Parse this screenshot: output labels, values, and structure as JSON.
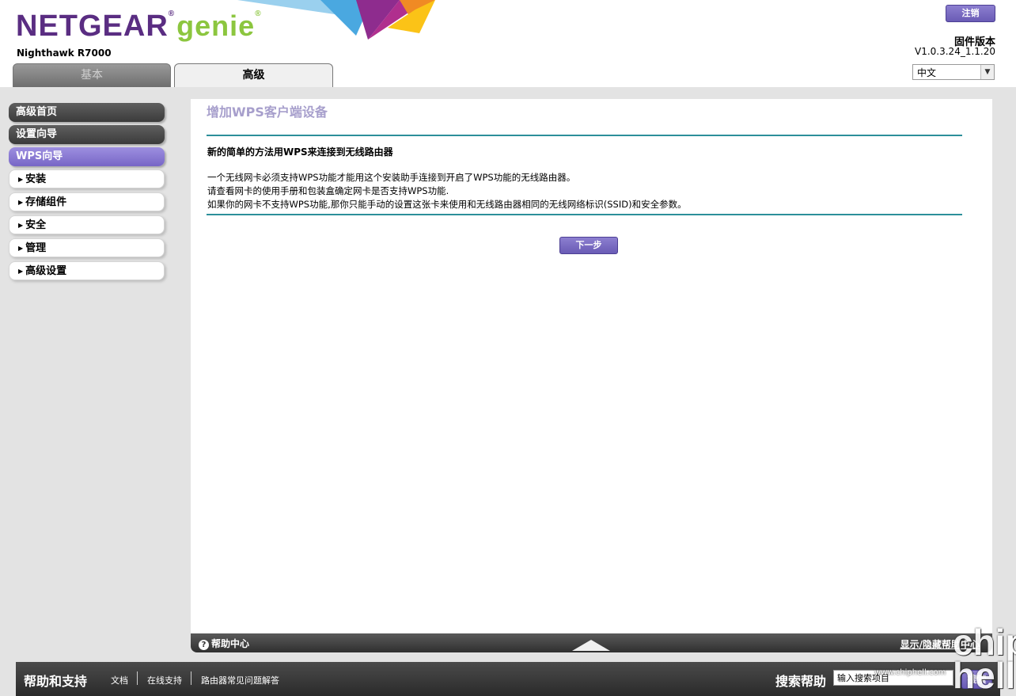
{
  "header": {
    "brand": "NETGEAR",
    "brand_mark": "®",
    "product": "genie",
    "product_mark": "®",
    "model": "Nighthawk R7000",
    "logout_label": "注销",
    "firmware_label": "固件版本",
    "firmware_version": "V1.0.3.24_1.1.20",
    "language": "中文"
  },
  "tabs": [
    {
      "label": "基本",
      "active": false
    },
    {
      "label": "高级",
      "active": true
    }
  ],
  "sidebar": {
    "items": [
      {
        "label": "高级首页",
        "style": "dark"
      },
      {
        "label": "设置向导",
        "style": "dark"
      },
      {
        "label": "WPS向导",
        "style": "active"
      },
      {
        "label": "安装",
        "style": "collapsible"
      },
      {
        "label": "存储组件",
        "style": "collapsible"
      },
      {
        "label": "安全",
        "style": "collapsible"
      },
      {
        "label": "管理",
        "style": "collapsible"
      },
      {
        "label": "高级设置",
        "style": "collapsible"
      }
    ],
    "expander_icon": "▶"
  },
  "main": {
    "title": "增加WPS客户端设备",
    "heading": "新的简单的方法用WPS来连接到无线路由器",
    "lines": [
      "一个无线网卡必须支持WPS功能才能用这个安装助手连接到开启了WPS功能的无线路由器。",
      "请查看网卡的使用手册和包装盒确定网卡是否支持WPS功能.",
      "如果你的网卡不支持WPS功能,那你只能手动的设置这张卡来使用和无线路由器相同的无线网络标识(SSID)和安全参数。"
    ],
    "next_label": "下一步"
  },
  "helpbar": {
    "help_center": "帮助中心",
    "toggle_label": "显示/隐藏帮助中心"
  },
  "footer": {
    "title": "帮助和支持",
    "links": [
      "文档",
      "在线支持",
      "路由器常见问题解答"
    ],
    "search_label": "搜索帮助",
    "search_value": "输入搜索项目",
    "search_button": "搜索"
  },
  "watermark": {
    "url": "www.chiphell.com",
    "logo": "chip hell"
  },
  "colors": {
    "brand_purple": "#5a2d82",
    "genie_green": "#8cc63f",
    "accent_button": "#7766c6",
    "rule_teal": "#2d8f9a",
    "title_lavender": "#a79fcc"
  }
}
